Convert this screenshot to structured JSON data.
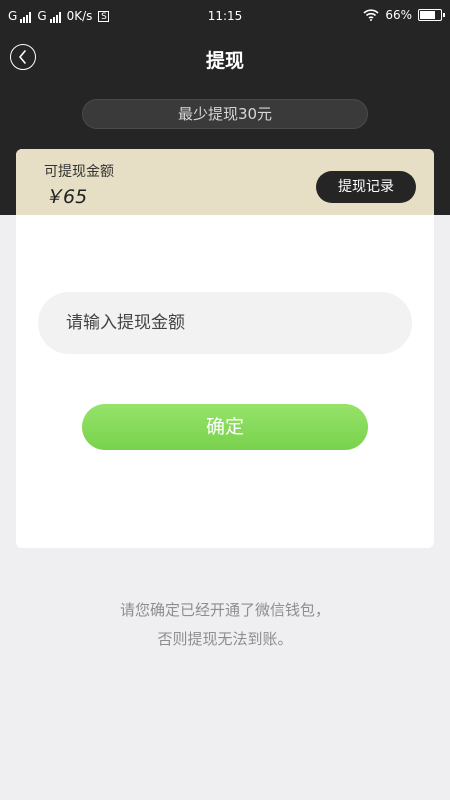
{
  "status_bar": {
    "carrier_1": "G",
    "carrier_2": "G",
    "net_speed": "0K/s",
    "s_badge": "S",
    "time": "11:15",
    "battery": "66%"
  },
  "header": {
    "title": "提现",
    "back_icon": "chevron-left-circle-icon"
  },
  "minimum_notice": "最少提现30元",
  "balance": {
    "label": "可提现金额",
    "amount": "￥65",
    "record_button": "提现记录"
  },
  "form": {
    "amount_placeholder": "请输入提现金额",
    "amount_value": "",
    "confirm_button": "确定"
  },
  "notice": {
    "line1": "请您确定已经开通了微信钱包，",
    "line2": "否则提现无法到账。"
  },
  "colors": {
    "header_bg": "#252525",
    "balance_bg": "#e6dec5",
    "confirm_green": "#86da5a",
    "page_bg": "#efeff2"
  }
}
